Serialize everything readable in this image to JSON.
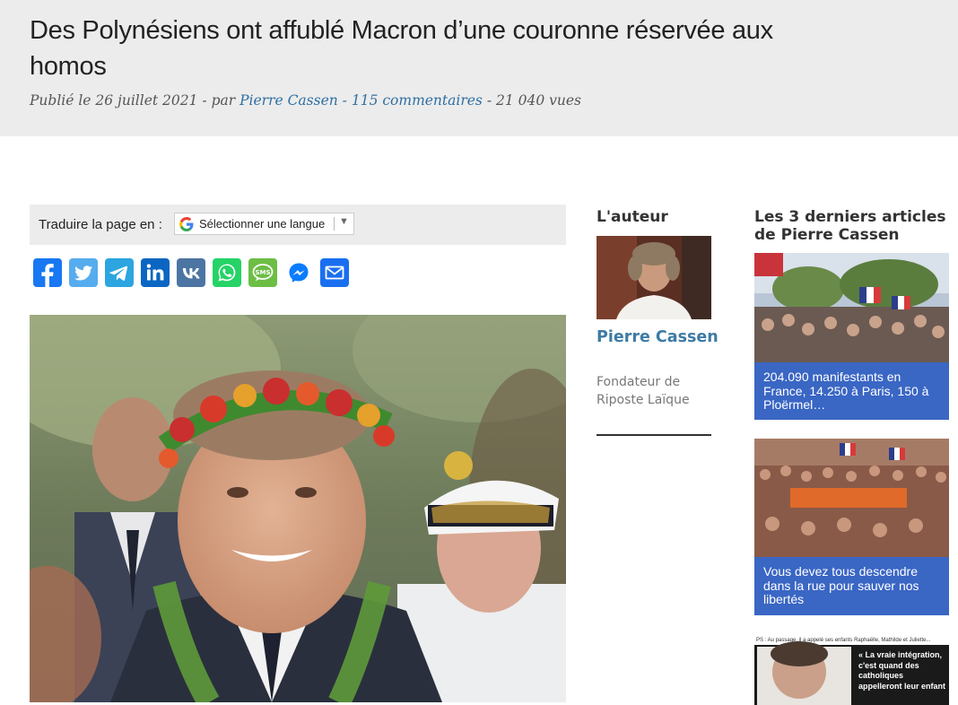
{
  "article": {
    "title": "Des Polynésiens ont affublé Macron d’une couronne réservée aux homos",
    "meta_prefix": "Publié le 26 juillet 2021 - par ",
    "author_link": "Pierre Cassen",
    "meta_sep1": " - ",
    "comments_link": "115 commentaires",
    "meta_sep2": " - 21 040 vues"
  },
  "translate": {
    "label": "Traduire la page en :",
    "select_value": "Sélectionner une langue",
    "arrow": "▼"
  },
  "share_icons": [
    "facebook-icon",
    "twitter-icon",
    "telegram-icon",
    "linkedin-icon",
    "vk-icon",
    "whatsapp-icon",
    "sms-icon",
    "messenger-icon",
    "email-icon"
  ],
  "share_sms_text": "SMS",
  "author_box": {
    "heading": "L'auteur",
    "name": "Pierre Cassen",
    "bio": "Fondateur de Riposte Laïque"
  },
  "latest": {
    "heading": "Les 3 derniers articles de Pierre Cassen",
    "items": [
      {
        "caption": "204.090 manifestants en France, 14.250 à Paris, 150 à Ploërmel…"
      },
      {
        "caption": "Vous devez tous descendre dans la rue pour sauver nos libertés"
      },
      {
        "caption": ""
      }
    ],
    "third_thumb_top_text": "PS : Au passage, il a appelé ses enfants Raphaëlle, Mathilde et Juliette...",
    "third_thumb_quote": "« La vraie intégration, c'est quand des catholiques appelleront leur enfant"
  },
  "colors": {
    "header_bg": "#ececec",
    "link": "#2e6fa3",
    "author_name": "#3d7ba5",
    "caption_bg": "#3a66c4"
  }
}
